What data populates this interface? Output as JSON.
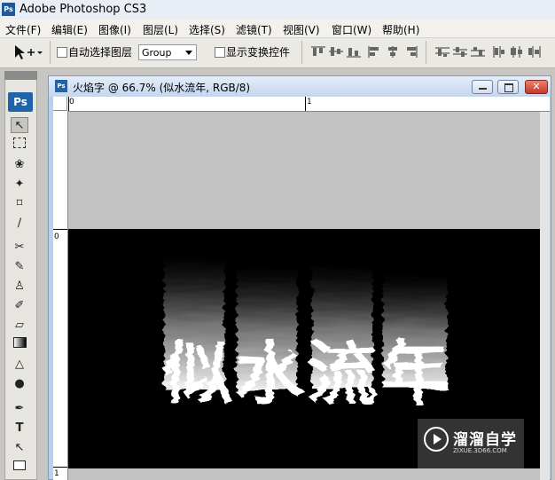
{
  "app": {
    "title": "Adobe Photoshop CS3",
    "logo": "Ps"
  },
  "menu": [
    {
      "label": "文件(F)"
    },
    {
      "label": "编辑(E)"
    },
    {
      "label": "图像(I)"
    },
    {
      "label": "图层(L)"
    },
    {
      "label": "选择(S)"
    },
    {
      "label": "滤镜(T)"
    },
    {
      "label": "视图(V)"
    },
    {
      "label": "窗口(W)"
    },
    {
      "label": "帮助(H)"
    }
  ],
  "options": {
    "auto_select_label": "自动选择图层",
    "auto_select_value": "Group",
    "show_transform_label": "显示变换控件"
  },
  "toolbox": {
    "logo": "Ps"
  },
  "document": {
    "title": "火焰字 @ 66.7% (似水流年, RGB/8)",
    "ruler_top": [
      "0",
      "1"
    ],
    "ruler_left": [
      "0",
      "1"
    ],
    "canvas_text": "似水流年"
  },
  "watermark": {
    "name": "溜溜自学",
    "url": "ZIXUE.3D66.COM"
  },
  "colors": {
    "accent": "#1f63aa",
    "canvas": "#000000",
    "pasteboard": "#c2c2c2"
  }
}
